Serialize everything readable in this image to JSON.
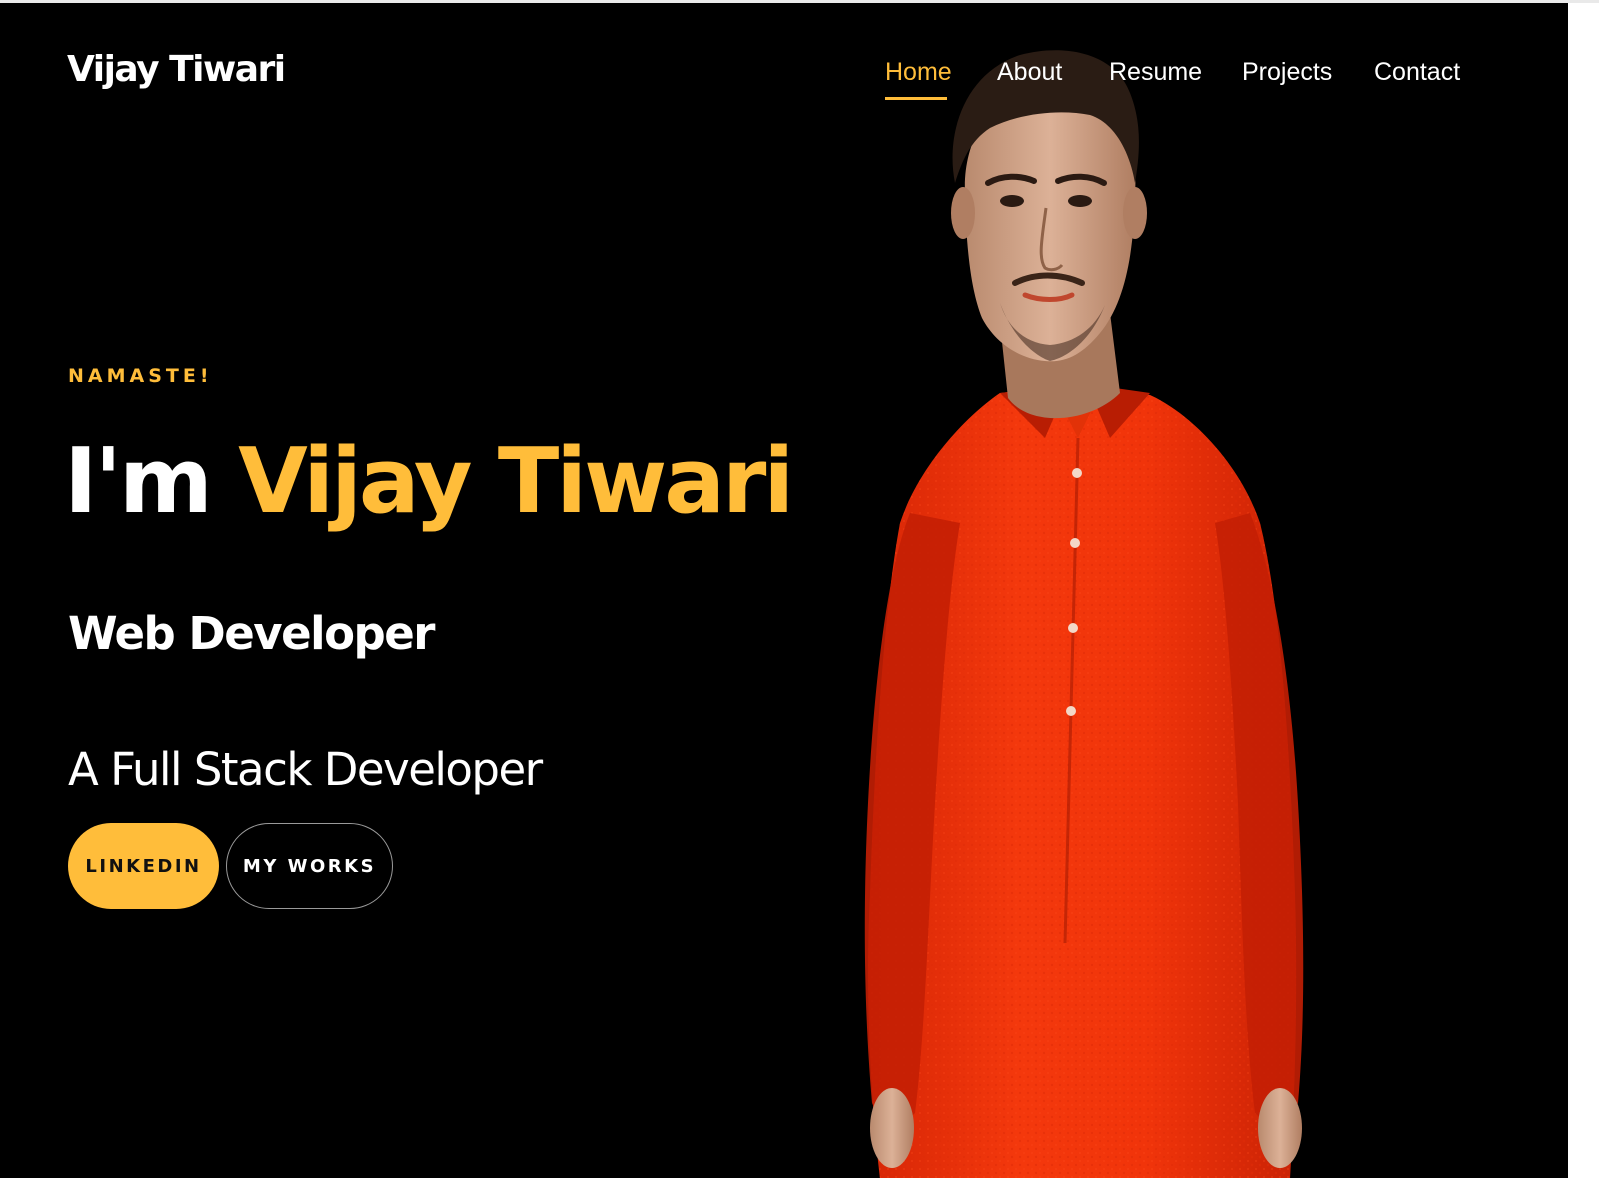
{
  "header": {
    "brand": "Vijay Tiwari",
    "nav": [
      {
        "label": "Home",
        "active": true
      },
      {
        "label": "About",
        "active": false
      },
      {
        "label": "Resume",
        "active": false
      },
      {
        "label": "Projects",
        "active": false
      },
      {
        "label": "Contact",
        "active": false
      }
    ]
  },
  "hero": {
    "greeting": "NAMASTE!",
    "headline_prefix": "I'm ",
    "headline_name": "Vijay Tiwari",
    "role": "Web Developer",
    "tagline": "A Full Stack Developer",
    "buttons": {
      "primary": "LINKEDIN",
      "secondary": "MY WORKS"
    }
  },
  "colors": {
    "accent": "#ffbd3a",
    "background": "#000000",
    "text": "#ffffff",
    "kurta": "#f2320a"
  }
}
